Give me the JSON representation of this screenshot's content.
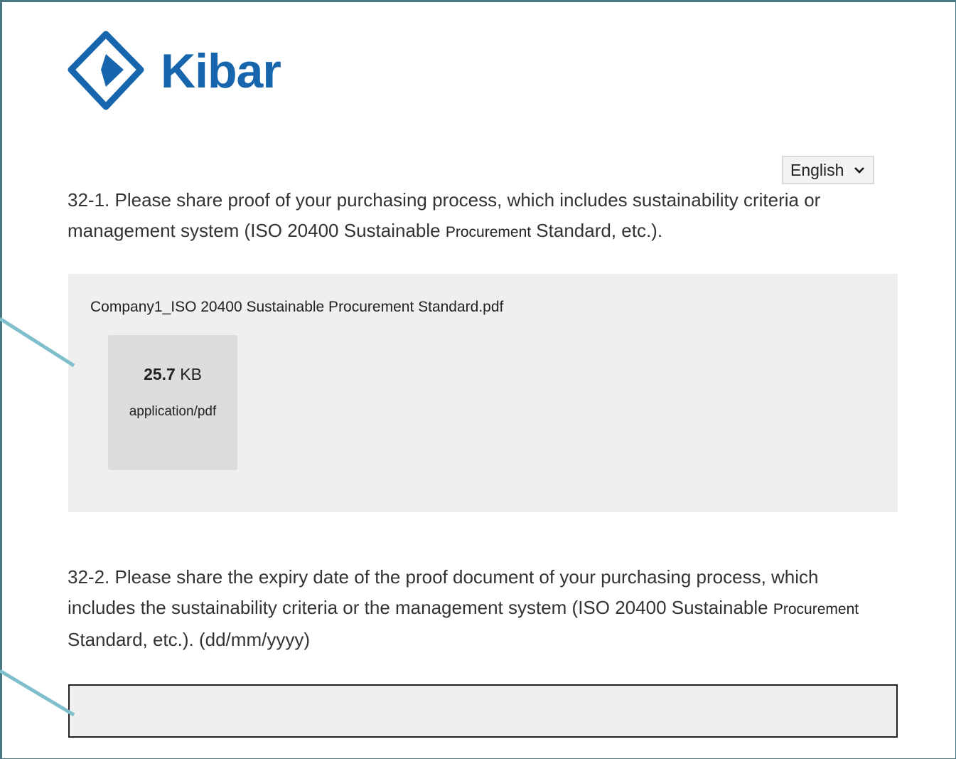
{
  "brand": {
    "name": "Kibar",
    "color": "#1665ad"
  },
  "language_select": {
    "value": "English"
  },
  "question_1": {
    "text_a": "32-1. Please share proof of your purchasing process, which includes sustainability criteria or management system (ISO 20400 Sustainable ",
    "text_small": "Procurement",
    "text_b": " Standard, etc.)."
  },
  "attachment": {
    "file_name": "Company1_ISO 20400 Sustainable Procurement Standard.pdf",
    "size_value": "25.7",
    "size_unit": "KB",
    "mime_type": "application/pdf"
  },
  "question_2": {
    "text_a": "32-2. Please share the expiry date of the proof document of your purchasing process, which includes the sustainability criteria or the management system (ISO 20400 Sustainable ",
    "text_small": "Procurement",
    "text_b": " Standard, etc.). (dd/mm/yyyy)"
  },
  "date_field": {
    "value": ""
  },
  "colors": {
    "pointer": "#7fbfcc",
    "frame": "#4a7683"
  }
}
